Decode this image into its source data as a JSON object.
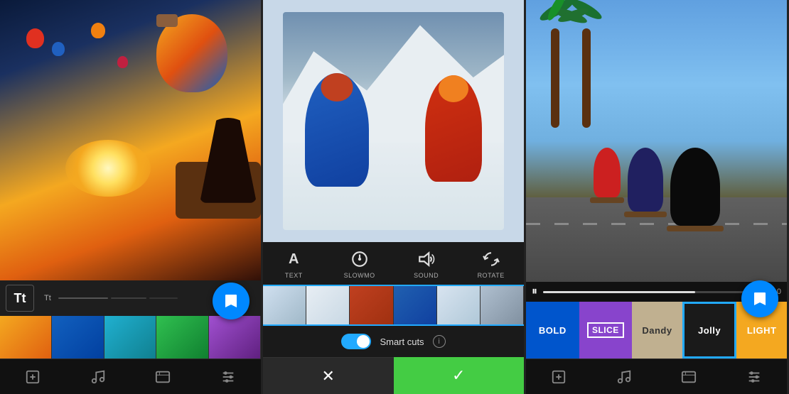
{
  "panels": [
    {
      "id": "panel1",
      "filmstrip": [
        "orange",
        "blue",
        "teal",
        "green",
        "purple"
      ],
      "text_tool_label": "Tt",
      "text_sub_label": "Tt",
      "fab_icon": "bookmark",
      "nav_icons": [
        "plus-icon",
        "music-icon",
        "gallery-icon",
        "settings-icon"
      ]
    },
    {
      "id": "panel2",
      "tools": [
        {
          "icon": "A",
          "label": "TEXT"
        },
        {
          "icon": "⊙",
          "label": "SLOWMO"
        },
        {
          "icon": "♪",
          "label": "SOUND"
        },
        {
          "icon": "↻",
          "label": "ROTATE"
        }
      ],
      "filmstrip": [
        "snow",
        "red",
        "blue2",
        "teal2",
        "snow2"
      ],
      "smart_cuts_label": "Smart cuts",
      "toggle_on": true,
      "cancel_icon": "✕",
      "confirm_icon": "✓"
    },
    {
      "id": "panel3",
      "play_icon": "⏸",
      "time": "1:10",
      "progress": 70,
      "themes": [
        {
          "id": "bold",
          "label": "BOLD",
          "color": "#0055cc",
          "text_color": "#ffffff"
        },
        {
          "id": "slice",
          "label": "SLICE",
          "color": "#8844cc",
          "text_color": "#ffffff",
          "boxed": true
        },
        {
          "id": "dandy",
          "label": "Dandy",
          "color": "#c0b090",
          "text_color": "#333333"
        },
        {
          "id": "jolly",
          "label": "Jolly",
          "color": "#1a1a1a",
          "text_color": "#ffffff",
          "selected": true
        },
        {
          "id": "light",
          "label": "LIGHT",
          "color": "#f4a820",
          "text_color": "#ffffff"
        }
      ],
      "fab_icon": "bookmark",
      "nav_icons": [
        "plus-icon",
        "music-icon",
        "gallery-icon",
        "settings-icon"
      ]
    }
  ]
}
